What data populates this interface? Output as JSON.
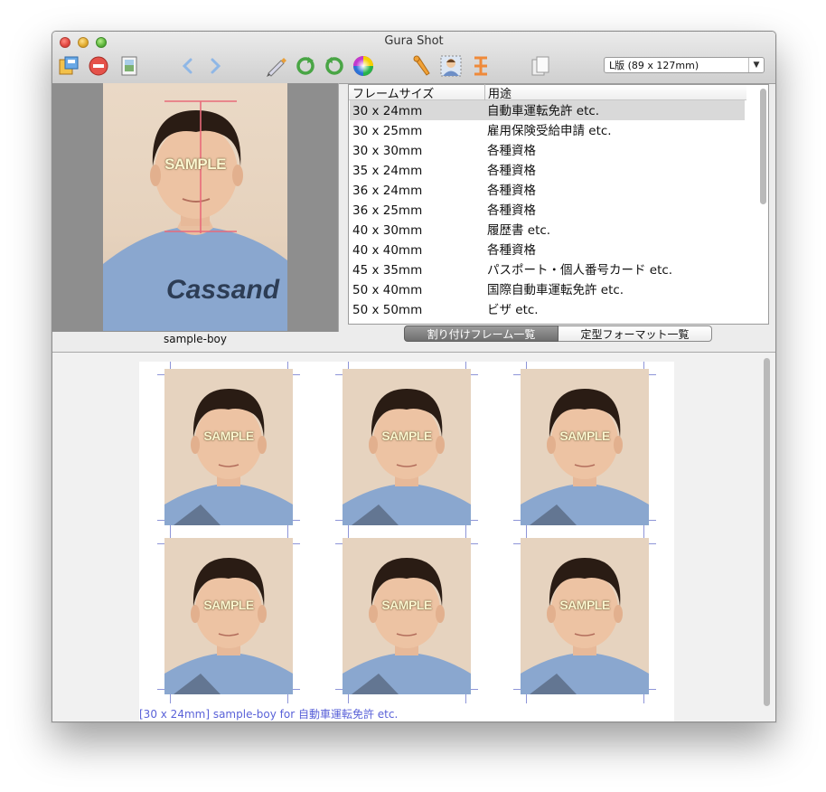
{
  "window": {
    "title": "Gura Shot"
  },
  "toolbar": {
    "icons": [
      "save-icon",
      "delete-icon",
      "photo-frame-icon",
      "back-arrow-icon",
      "forward-arrow-icon",
      "pen-icon",
      "rotate-icon",
      "rotate-icon",
      "color-wheel-icon",
      "wrench-icon",
      "person-icon",
      "vertical-guide-icon",
      "page-icon"
    ],
    "paper_size": "L版 (89 x 127mm)"
  },
  "preview": {
    "watermark": "SAMPLE",
    "filename": "sample-boy"
  },
  "frame_table": {
    "columns": [
      "フレームサイズ",
      "用途"
    ],
    "rows": [
      {
        "size": "30 x 24mm",
        "use": "自動車運転免許 etc."
      },
      {
        "size": "30 x 25mm",
        "use": "雇用保険受給申請 etc."
      },
      {
        "size": "30 x 30mm",
        "use": "各種資格"
      },
      {
        "size": "35 x 24mm",
        "use": "各種資格"
      },
      {
        "size": "36 x 24mm",
        "use": "各種資格"
      },
      {
        "size": "36 x 25mm",
        "use": "各種資格"
      },
      {
        "size": "40 x 30mm",
        "use": "履歴書 etc."
      },
      {
        "size": "40 x 40mm",
        "use": "各種資格"
      },
      {
        "size": "45 x 35mm",
        "use": "パスポート・個人番号カード etc."
      },
      {
        "size": "50 x 40mm",
        "use": "国際自動車運転免許 etc."
      },
      {
        "size": "50 x 50mm",
        "use": "ビザ etc."
      }
    ]
  },
  "tabs": {
    "active": "割り付けフレーム一覧",
    "inactive": "定型フォーマット一覧"
  },
  "layout": {
    "caption": "[30 x 24mm] sample-boy for 自動車運転免許 etc."
  }
}
